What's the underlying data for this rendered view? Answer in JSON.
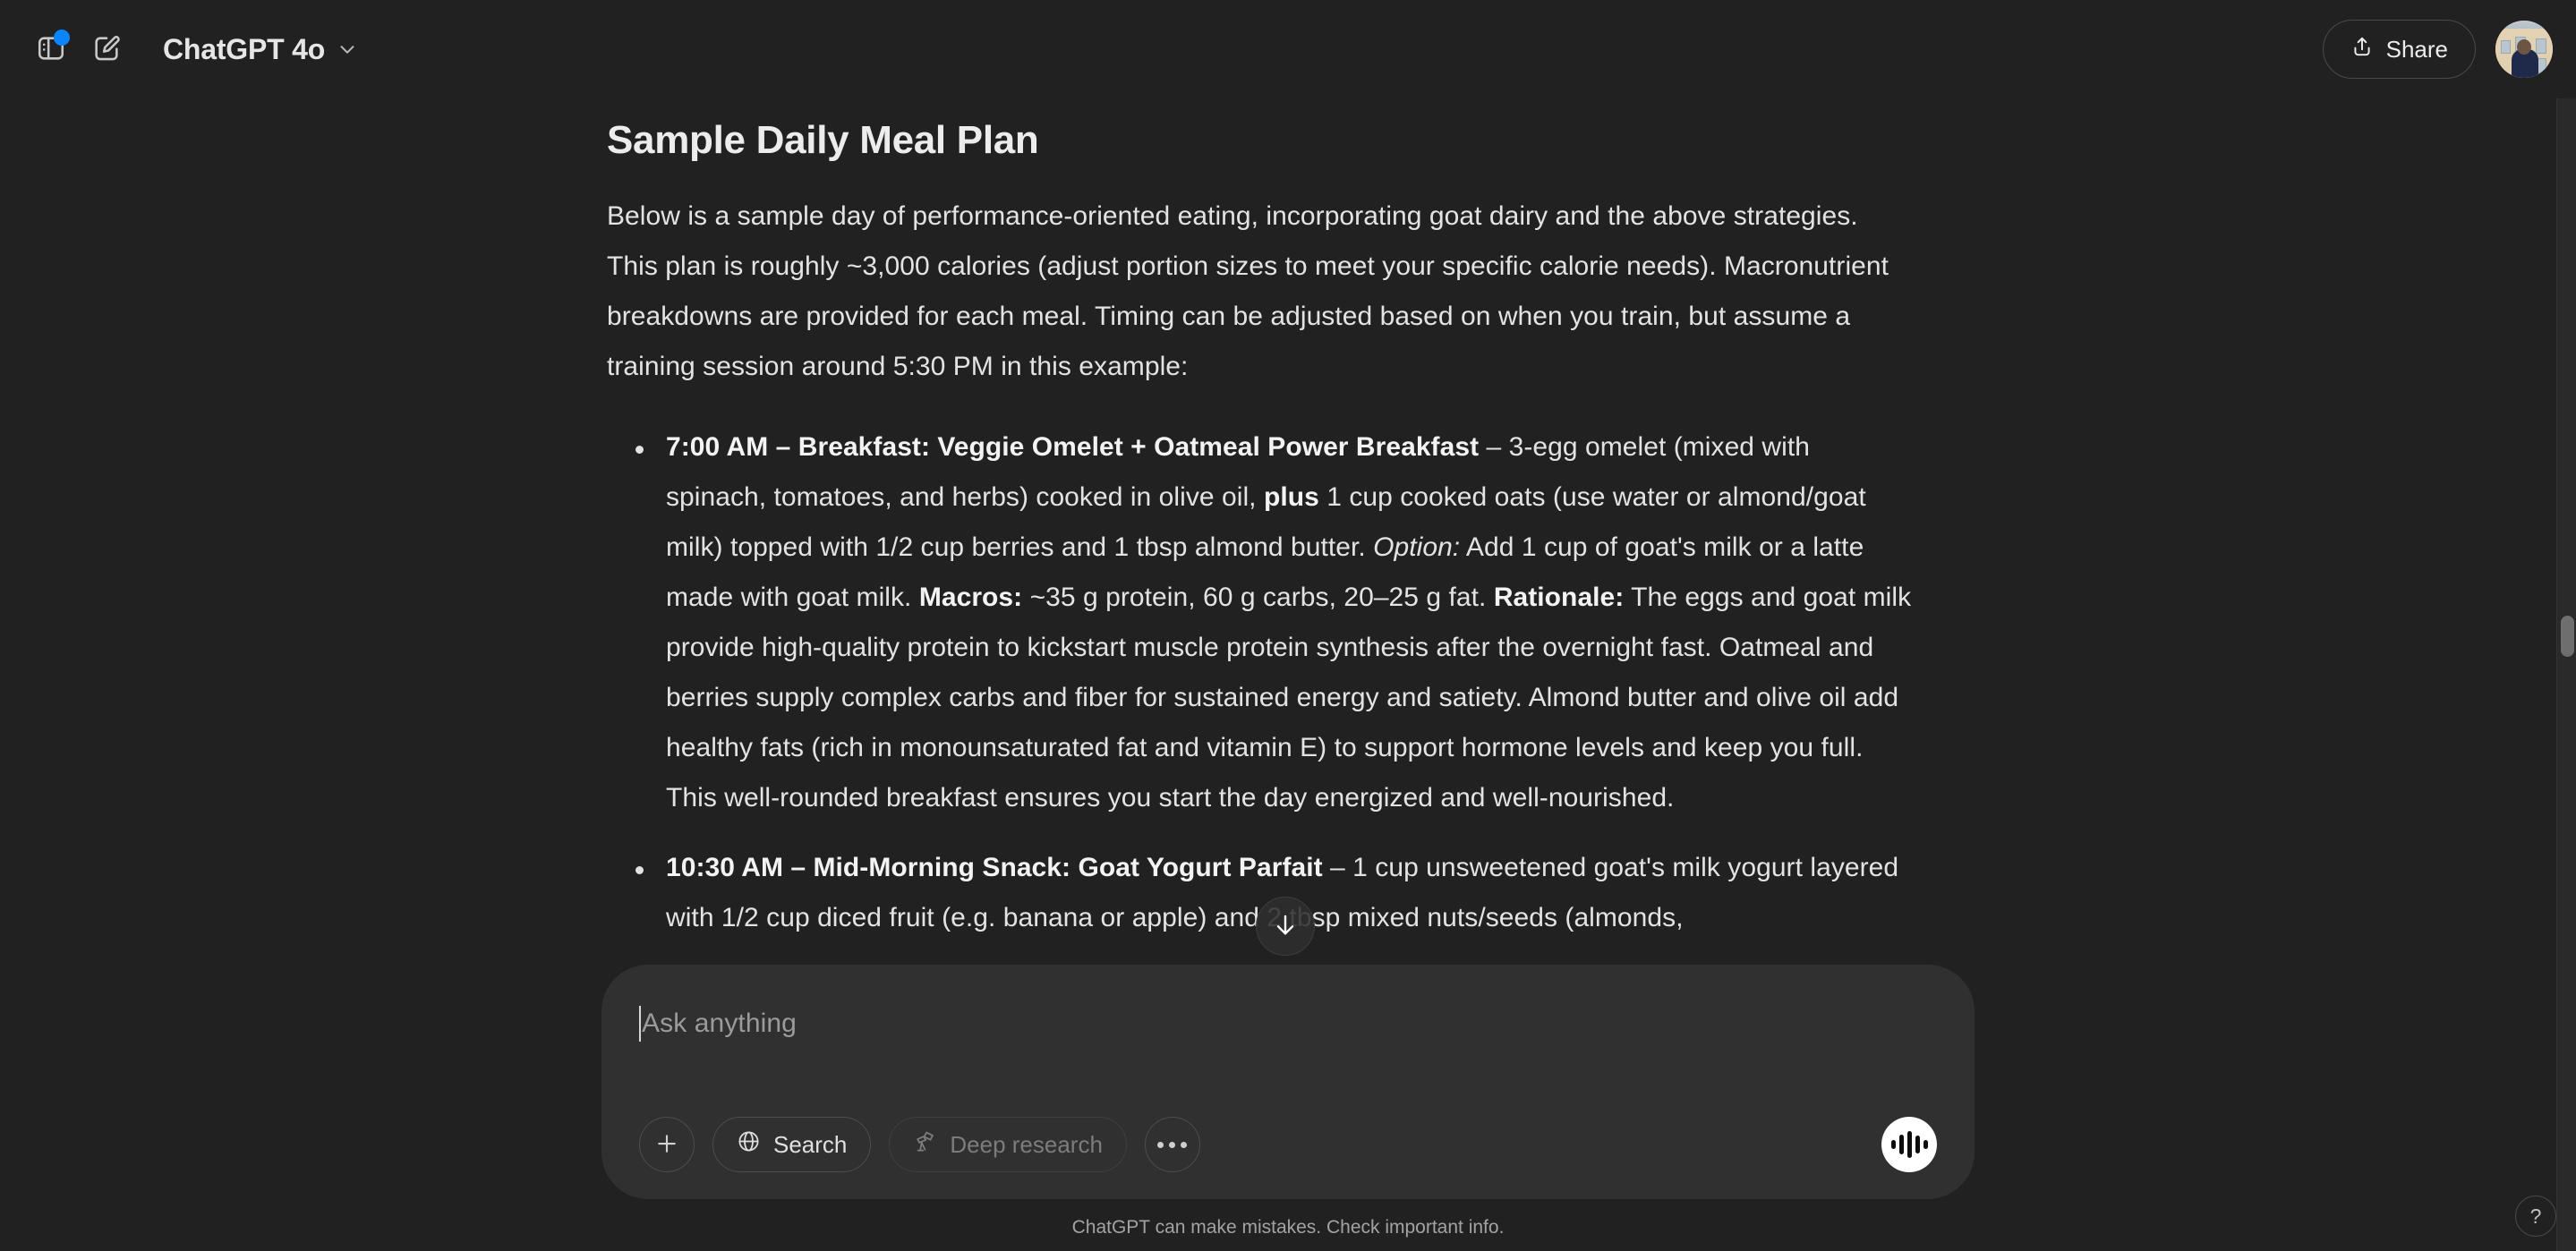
{
  "header": {
    "sidebar_toggle_icon": "sidebar-panel-icon",
    "new_chat_icon": "compose-pencil-icon",
    "model_name": "ChatGPT 4o",
    "model_chevron_icon": "chevron-down-icon",
    "share_label": "Share",
    "share_icon": "share-upload-icon",
    "avatar_label": "user-avatar",
    "badge_color": "#0b84ff"
  },
  "conversation": {
    "title": "Sample Daily Meal Plan",
    "intro": "Below is a sample day of performance-oriented eating, incorporating goat dairy and the above strategies. This plan is roughly ~3,000 calories (adjust portion sizes to meet your specific calorie needs). Macronutrient breakdowns are provided for each meal. Timing can be adjusted based on when you train, but assume a training session around 5:30 PM in this example:",
    "bullets": [
      {
        "heading": "7:00 AM – Breakfast: Veggie Omelet + Oatmeal Power Breakfast",
        "body_1": " – 3-egg omelet (mixed with spinach, tomatoes, and herbs) cooked in olive oil, ",
        "emph_1": "plus",
        "body_2": " 1 cup cooked oats (use water or almond/goat milk) topped with 1/2 cup berries and 1 tbsp almond butter. ",
        "italic_1": "Option:",
        "body_3": " Add 1 cup of goat's milk or a latte made with goat milk. ",
        "label_macros": "Macros:",
        "macros_text": " ~35 g protein, 60 g carbs, 20–25 g fat. ",
        "label_rationale": "Rationale:",
        "rationale_text": " The eggs and goat milk provide high-quality protein to kickstart muscle protein synthesis after the overnight fast. Oatmeal and berries supply complex carbs and fiber for sustained energy and satiety. Almond butter and olive oil add healthy fats (rich in monounsaturated fat and vitamin E) to support hormone levels and keep you full. This well-rounded breakfast ensures you start the day energized and well-nourished."
      },
      {
        "heading": "10:30 AM – Mid-Morning Snack: Goat Yogurt Parfait",
        "body_1": " – 1 cup unsweetened goat's milk yogurt layered with 1/2 cup diced fruit (e.g. banana or apple) and 2 tbsp mixed nuts/seeds (almonds,"
      }
    ],
    "scroll_down_icon": "arrow-down-icon"
  },
  "composer": {
    "placeholder": "Ask anything",
    "attach_icon": "plus-icon",
    "search_label": "Search",
    "search_icon": "globe-icon",
    "deep_research_label": "Deep research",
    "deep_research_icon": "telescope-icon",
    "more_icon": "ellipsis-icon",
    "voice_icon": "voice-waveform-icon"
  },
  "footer": {
    "disclaimer": "ChatGPT can make mistakes. Check important info.",
    "help_label": "?"
  }
}
